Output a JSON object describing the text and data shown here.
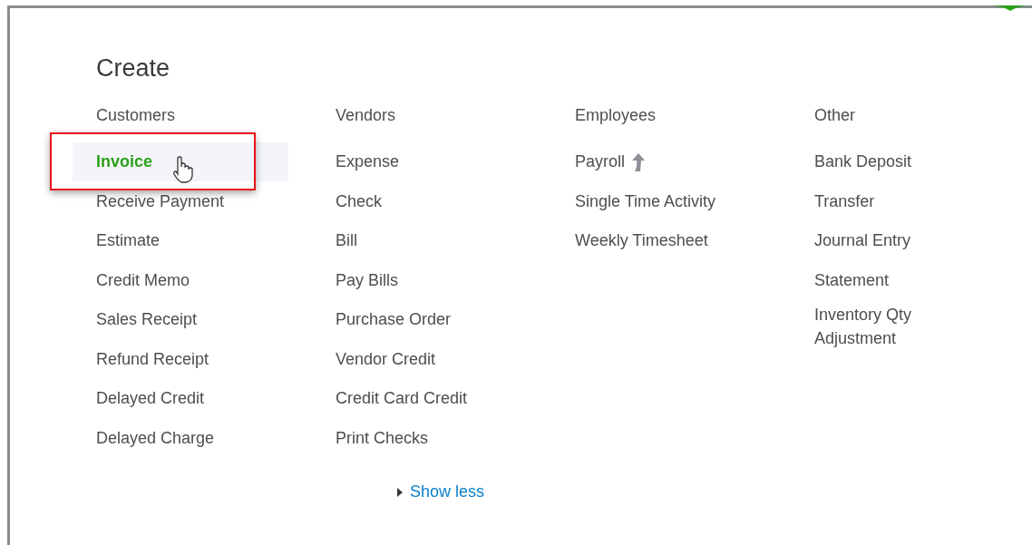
{
  "title": "Create",
  "columns": [
    {
      "heading": "Customers",
      "items": [
        {
          "label": "Invoice",
          "selected": true,
          "kind": "plain"
        },
        {
          "label": "Receive Payment",
          "selected": false,
          "kind": "plain"
        },
        {
          "label": "Estimate",
          "selected": false,
          "kind": "plain"
        },
        {
          "label": "Credit Memo",
          "selected": false,
          "kind": "plain"
        },
        {
          "label": "Sales Receipt",
          "selected": false,
          "kind": "plain"
        },
        {
          "label": "Refund Receipt",
          "selected": false,
          "kind": "plain"
        },
        {
          "label": "Delayed Credit",
          "selected": false,
          "kind": "plain"
        },
        {
          "label": "Delayed Charge",
          "selected": false,
          "kind": "plain"
        }
      ]
    },
    {
      "heading": "Vendors",
      "items": [
        {
          "label": "Expense",
          "selected": false,
          "kind": "plain"
        },
        {
          "label": "Check",
          "selected": false,
          "kind": "plain"
        },
        {
          "label": "Bill",
          "selected": false,
          "kind": "plain"
        },
        {
          "label": "Pay Bills",
          "selected": false,
          "kind": "plain"
        },
        {
          "label": "Purchase Order",
          "selected": false,
          "kind": "plain"
        },
        {
          "label": "Vendor Credit",
          "selected": false,
          "kind": "plain"
        },
        {
          "label": "Credit Card Credit",
          "selected": false,
          "kind": "plain"
        },
        {
          "label": "Print Checks",
          "selected": false,
          "kind": "plain"
        }
      ]
    },
    {
      "heading": "Employees",
      "items": [
        {
          "label": "Payroll",
          "selected": false,
          "kind": "upgrade"
        },
        {
          "label": "Single Time Activity",
          "selected": false,
          "kind": "plain"
        },
        {
          "label": "Weekly Timesheet",
          "selected": false,
          "kind": "plain"
        }
      ]
    },
    {
      "heading": "Other",
      "items": [
        {
          "label": "Bank Deposit",
          "selected": false,
          "kind": "plain"
        },
        {
          "label": "Transfer",
          "selected": false,
          "kind": "plain"
        },
        {
          "label": "Journal Entry",
          "selected": false,
          "kind": "plain"
        },
        {
          "label": "Statement",
          "selected": false,
          "kind": "plain"
        },
        {
          "label": "Inventory Qty Adjustment",
          "selected": false,
          "kind": "plain"
        }
      ]
    }
  ],
  "toggle": {
    "label": "Show less"
  }
}
